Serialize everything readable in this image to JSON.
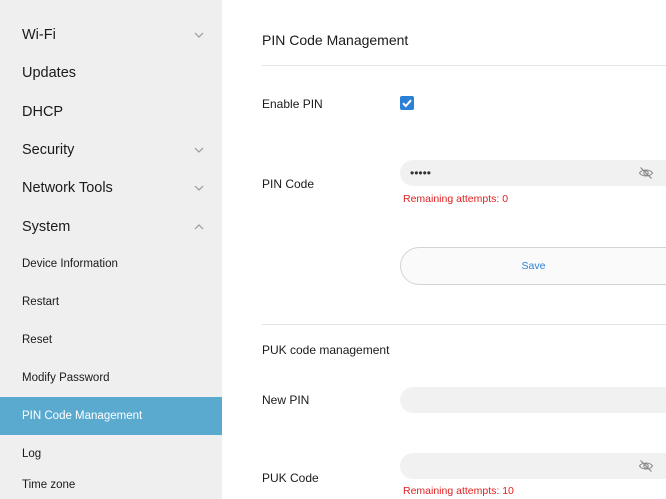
{
  "sidebar": {
    "menu": [
      {
        "label": "Wi-Fi",
        "chevron": "down"
      },
      {
        "label": "Updates",
        "chevron": ""
      },
      {
        "label": "DHCP",
        "chevron": ""
      },
      {
        "label": "Security",
        "chevron": "down"
      },
      {
        "label": "Network Tools",
        "chevron": "down"
      },
      {
        "label": "System",
        "chevron": "up"
      }
    ],
    "system_items": [
      {
        "label": "Device Information"
      },
      {
        "label": "Restart"
      },
      {
        "label": "Reset"
      },
      {
        "label": "Modify Password"
      },
      {
        "label": "PIN Code Management",
        "active": true
      },
      {
        "label": "Log"
      },
      {
        "label": "Time zone"
      }
    ]
  },
  "pin_management": {
    "title": "PIN Code Management",
    "enable_pin_label": "Enable PIN",
    "enable_pin_checked": true,
    "pin_code_label": "PIN Code",
    "pin_code_value": "•••••",
    "pin_eye_icon": "eye-off-icon",
    "pin_remaining": "Remaining attempts: 0",
    "save_label": "Save"
  },
  "puk_management": {
    "title": "PUK code management",
    "new_pin_label": "New PIN",
    "new_pin_value": "",
    "puk_code_label": "PUK Code",
    "puk_code_value": "",
    "puk_eye_icon": "eye-off-icon",
    "puk_remaining": "Remaining attempts: 10"
  },
  "colors": {
    "active_item_bg": "#5aa9cf",
    "checkbox": "#2a7fd6",
    "error_text": "#e02020",
    "save_text": "#2a7fd6",
    "sidebar_bg": "#efefef"
  }
}
